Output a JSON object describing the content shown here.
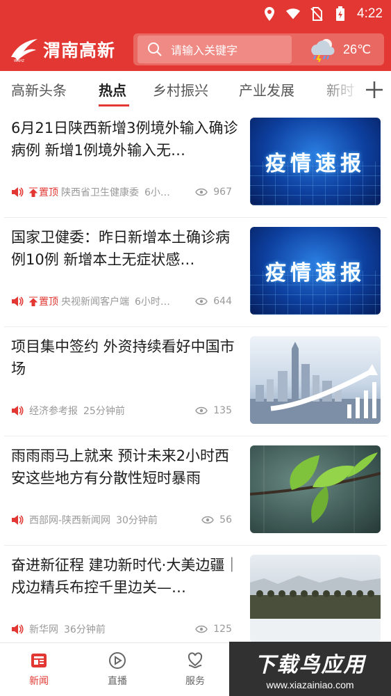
{
  "status_bar": {
    "time": "4:22"
  },
  "app": {
    "logo_text": "渭南高新",
    "search_placeholder": "请输入关键字",
    "weather_temp": "26℃",
    "weather_icon": "thunderstorm-cloud-icon"
  },
  "tabs": [
    "高新头条",
    "热点",
    "乡村振兴",
    "产业发展",
    "新时"
  ],
  "active_tab": "热点",
  "news": [
    {
      "title": "6月21日陕西新增3例境外输入确诊病例 新增1例境外输入无…",
      "pinned": true,
      "pin_label": "置顶",
      "source": "陕西省卫生健康委",
      "time": "6小…",
      "views": "967",
      "thumb_text": "疫情速报"
    },
    {
      "title": "国家卫健委：昨日新增本土确诊病例10例 新增本土无症状感…",
      "pinned": true,
      "pin_label": "置顶",
      "source": "央视新闻客户端",
      "time": "6小时…",
      "views": "644",
      "thumb_text": "疫情速报"
    },
    {
      "title": "项目集中签约 外资持续看好中国市场",
      "pinned": false,
      "pin_label": "",
      "source": "经济参考报",
      "time": "25分钟前",
      "views": "135",
      "thumb_text": ""
    },
    {
      "title": "雨雨雨马上就来 预计未来2小时西安这些地方有分散性短时暴雨",
      "pinned": false,
      "pin_label": "",
      "source": "西部网-陕西新闻网",
      "time": "30分钟前",
      "views": "56",
      "thumb_text": ""
    },
    {
      "title": "奋进新征程 建功新时代·大美边疆｜戍边精兵布控千里边关—…",
      "pinned": false,
      "pin_label": "",
      "source": "新华网",
      "time": "36分钟前",
      "views": "125",
      "thumb_text": ""
    }
  ],
  "bottom_nav": [
    {
      "label": "新闻",
      "icon": "news-icon",
      "active": true
    },
    {
      "label": "直播",
      "icon": "play-circle-icon",
      "active": false
    },
    {
      "label": "服务",
      "icon": "heart-hand-icon",
      "active": false
    }
  ],
  "watermark": {
    "line1": "下载鸟应用",
    "line2": "www.xiazainiao.com"
  },
  "colors": {
    "brand_red": "#e23732",
    "text_gray": "#999999"
  }
}
